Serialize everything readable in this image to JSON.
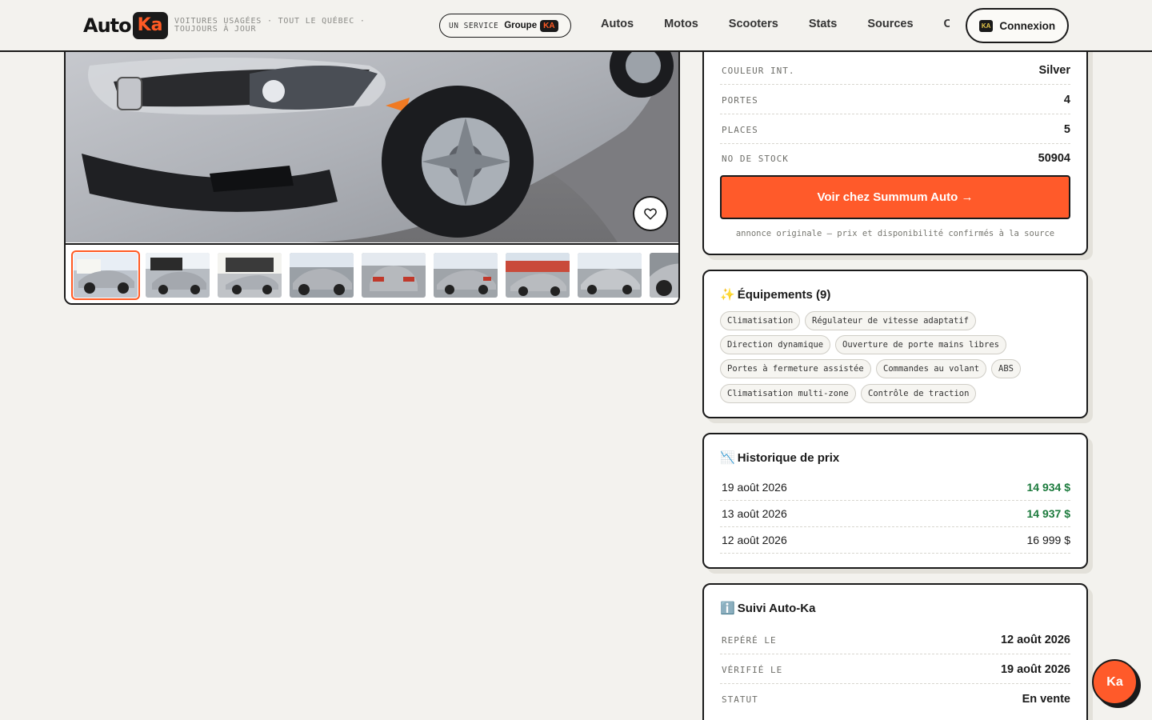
{
  "header": {
    "logo_auto": "Auto",
    "logo_ka": "Ka",
    "tagline": "VOITURES USAGÉES · TOUT LE QUÉBEC · TOUJOURS À JOUR",
    "service_pill": {
      "prefix": "UN SERVICE",
      "group": "Groupe",
      "group_badge": "KA"
    },
    "nav": [
      "Autos",
      "Motos",
      "Scooters",
      "Stats",
      "Sources",
      "Co"
    ],
    "login_badge": "KA",
    "login_label": "Connexion"
  },
  "specs": {
    "rows": [
      {
        "label": "COULEUR INT.",
        "value": "Silver"
      },
      {
        "label": "PORTES",
        "value": "4"
      },
      {
        "label": "PLACES",
        "value": "5"
      },
      {
        "label": "NO DE STOCK",
        "value": "50904"
      }
    ],
    "cta_label": "Voir chez Summum Auto →",
    "cta_note": "annonce originale — prix et disponibilité confirmés à la source"
  },
  "equipment": {
    "icon": "sparkles-icon",
    "emoji": "✨",
    "title": "Équipements (9)",
    "items": [
      "Climatisation",
      "Régulateur de vitesse adaptatif",
      "Direction dynamique",
      "Ouverture de porte mains libres",
      "Portes à fermeture assistée",
      "Commandes au volant",
      "ABS",
      "Climatisation multi-zone",
      "Contrôle de traction"
    ]
  },
  "price_history": {
    "icon": "chart-down-icon",
    "emoji": "📉",
    "title": "Historique de prix",
    "rows": [
      {
        "date": "19 août 2026",
        "price": "14 934 $",
        "drop": true
      },
      {
        "date": "13 août 2026",
        "price": "14 937 $",
        "drop": true
      },
      {
        "date": "12 août 2026",
        "price": "16 999 $",
        "drop": false
      }
    ],
    "drop_color": "#1b7a3c"
  },
  "tracking": {
    "icon": "info-icon",
    "emoji": "ℹ️",
    "title": "Suivi Auto-Ka",
    "rows": [
      {
        "label": "REPÉRÉ LE",
        "value": "12 août 2026"
      },
      {
        "label": "VÉRIFIÉ LE",
        "value": "19 août 2026"
      },
      {
        "label": "STATUT",
        "value": "En vente"
      }
    ]
  },
  "gallery": {
    "thumb_count": 9,
    "active_index": 0
  },
  "fab_label": "Ka",
  "colors": {
    "accent": "#ff5a2a",
    "ink": "#1a1a1a",
    "background": "#f3f2ee",
    "price_drop": "#1b7a3c"
  }
}
